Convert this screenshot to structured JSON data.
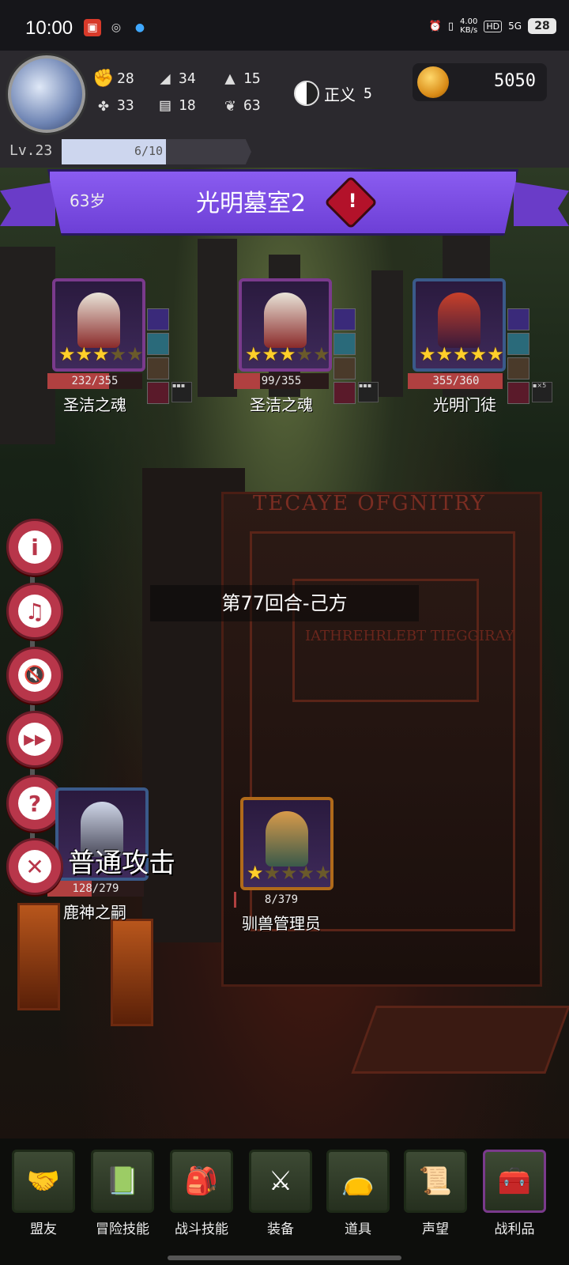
{
  "status_bar": {
    "time": "10:00",
    "net_speed": "4.00",
    "net_unit": "KB/s",
    "hd": "HD",
    "signal": "5G",
    "battery": "28"
  },
  "player": {
    "level_label": "Lv.23",
    "xp_text": "6/10",
    "xp_fraction": 0.6,
    "stats": [
      {
        "icon": "fist-icon",
        "value": "28"
      },
      {
        "icon": "boot-icon",
        "value": "34"
      },
      {
        "icon": "wizard-hat-icon",
        "value": "15"
      },
      {
        "icon": "clover-icon",
        "value": "33"
      },
      {
        "icon": "book-icon",
        "value": "18"
      },
      {
        "icon": "wings-icon",
        "value": "63"
      }
    ],
    "justice_label": "正义",
    "justice_value": "5",
    "gold": "5050"
  },
  "banner": {
    "age": "63岁",
    "location": "光明墓室2",
    "alert_glyph": "!"
  },
  "enemies": [
    {
      "name": "圣洁之魂",
      "hp_text": "232/355",
      "hp_fraction": 0.653,
      "stars": 3
    },
    {
      "name": "圣洁之魂",
      "hp_text": "99/355",
      "hp_fraction": 0.279,
      "stars": 3
    },
    {
      "name": "光明门徒",
      "hp_text": "355/360",
      "hp_fraction": 0.986,
      "stars": 5
    }
  ],
  "round_text": "第77回合-己方",
  "allies": [
    {
      "name": "鹿神之嗣",
      "hp_text": "128/279",
      "hp_fraction": 0.459
    },
    {
      "name": "驯兽管理员",
      "hp_text": "8/379",
      "hp_fraction": 0.021,
      "stars": 1
    }
  ],
  "action_label": "普通攻击",
  "door_text": "TECAYE OFGNITRY",
  "door_text2": "IATHREHRLEBT TIEGGIRAY",
  "side_buttons": [
    {
      "name": "info-button",
      "glyph": "i"
    },
    {
      "name": "music-off-button",
      "glyph": "♫"
    },
    {
      "name": "sound-off-button",
      "glyph": "🔇"
    },
    {
      "name": "fast-forward-button",
      "glyph": "▶▶"
    },
    {
      "name": "help-button",
      "glyph": "?"
    },
    {
      "name": "close-button",
      "glyph": "✕"
    }
  ],
  "nav": [
    {
      "label": "盟友",
      "icon": "handshake-icon"
    },
    {
      "label": "冒险技能",
      "icon": "spellbook-icon"
    },
    {
      "label": "战斗技能",
      "icon": "backpack-icon"
    },
    {
      "label": "装备",
      "icon": "shield-swords-icon"
    },
    {
      "label": "道具",
      "icon": "bag-icon"
    },
    {
      "label": "声望",
      "icon": "scroll-icon"
    },
    {
      "label": "战利品",
      "icon": "treasure-chest-icon"
    }
  ]
}
